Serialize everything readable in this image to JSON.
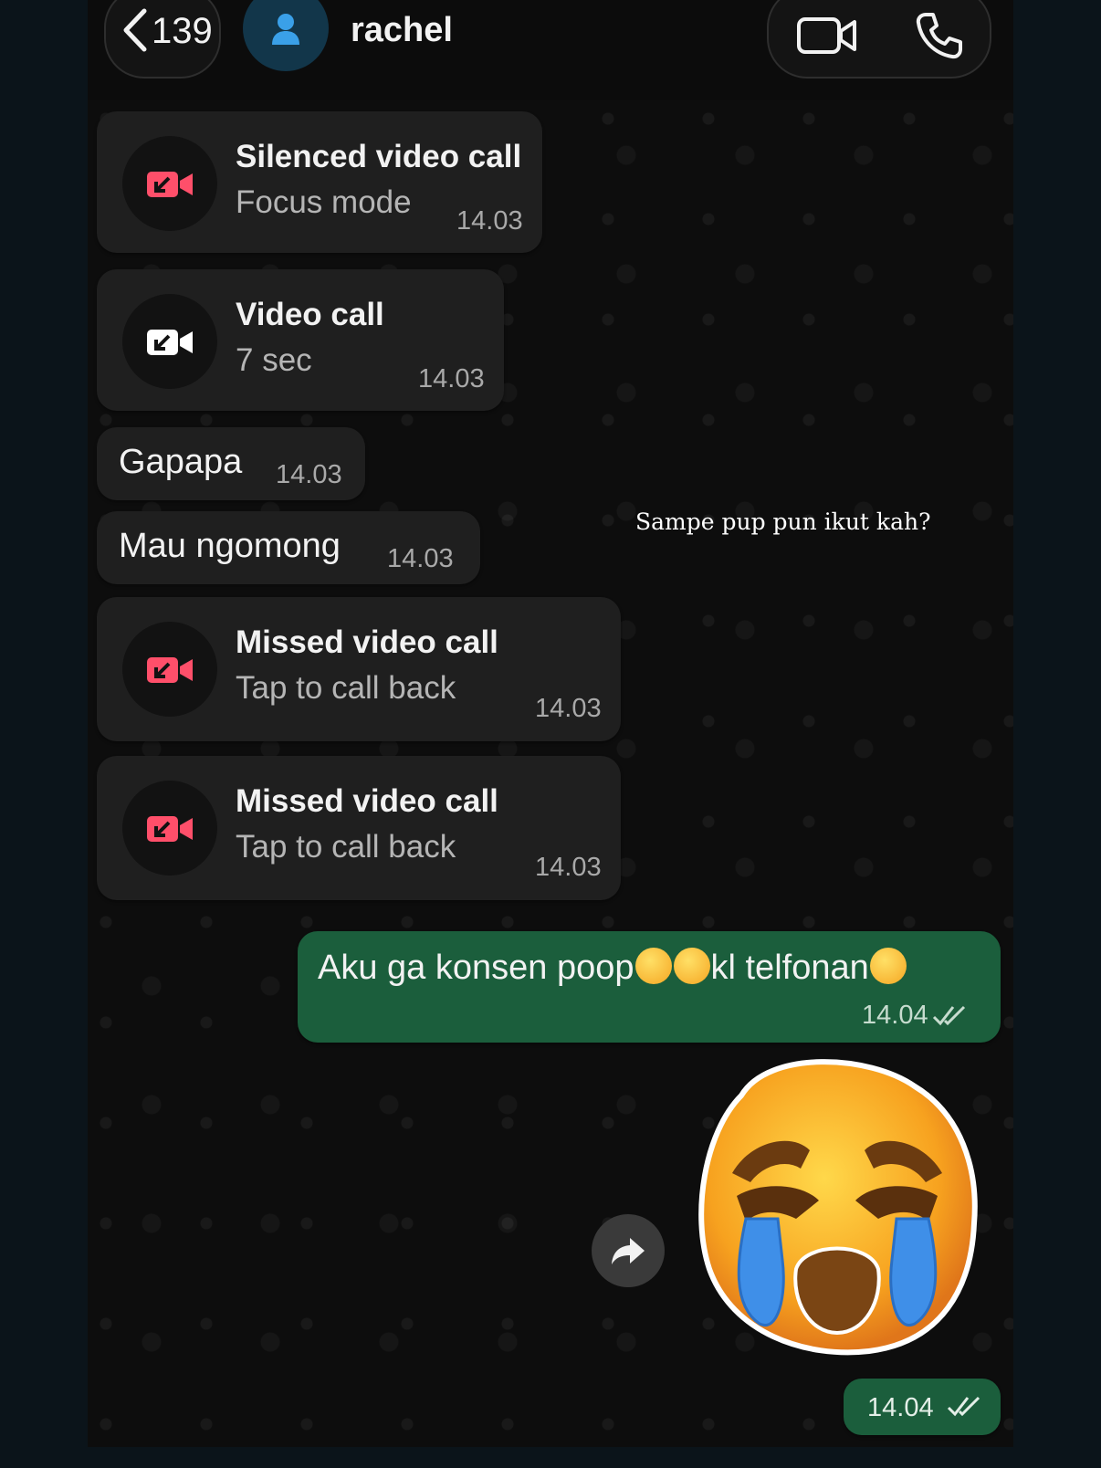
{
  "header": {
    "back_count": "139",
    "contact_name": "rachel",
    "video_icon": "video-camera-icon",
    "phone_icon": "phone-icon"
  },
  "messages": [
    {
      "type": "call",
      "title": "Silenced video call",
      "subtitle": "Focus mode",
      "time": "14.03",
      "icon_color": "#ff4f6a"
    },
    {
      "type": "call",
      "title": "Video call",
      "subtitle": "7 sec",
      "time": "14.03",
      "icon_color": "#ffffff"
    },
    {
      "type": "text",
      "text": "Gapapa",
      "time": "14.03"
    },
    {
      "type": "text",
      "text": "Mau ngomong",
      "time": "14.03"
    },
    {
      "type": "call",
      "title": "Missed video call",
      "subtitle": "Tap to call back",
      "time": "14.03",
      "icon_color": "#ff4f6a"
    },
    {
      "type": "call",
      "title": "Missed video call",
      "subtitle": "Tap to call back",
      "time": "14.03",
      "icon_color": "#ff4f6a"
    },
    {
      "type": "outgoing_text",
      "text_part1": "Aku ga konsen poop",
      "emoji1": "rolling-on-floor-laughing",
      "emoji2": "rolling-on-floor-laughing",
      "text_part2": "kl telfonan",
      "emoji3": "loudly-crying",
      "time": "14.04",
      "status": "read"
    },
    {
      "type": "outgoing_sticker",
      "sticker": "loudly-crying-melting-face",
      "time": "14.04",
      "status": "read"
    }
  ],
  "overlay_caption": "Sampe pup pun ikut kah?",
  "colors": {
    "outgoing_bubble": "#1b5e3c",
    "incoming_bubble": "#1f1f1f",
    "missed_red": "#ff4f6a"
  }
}
